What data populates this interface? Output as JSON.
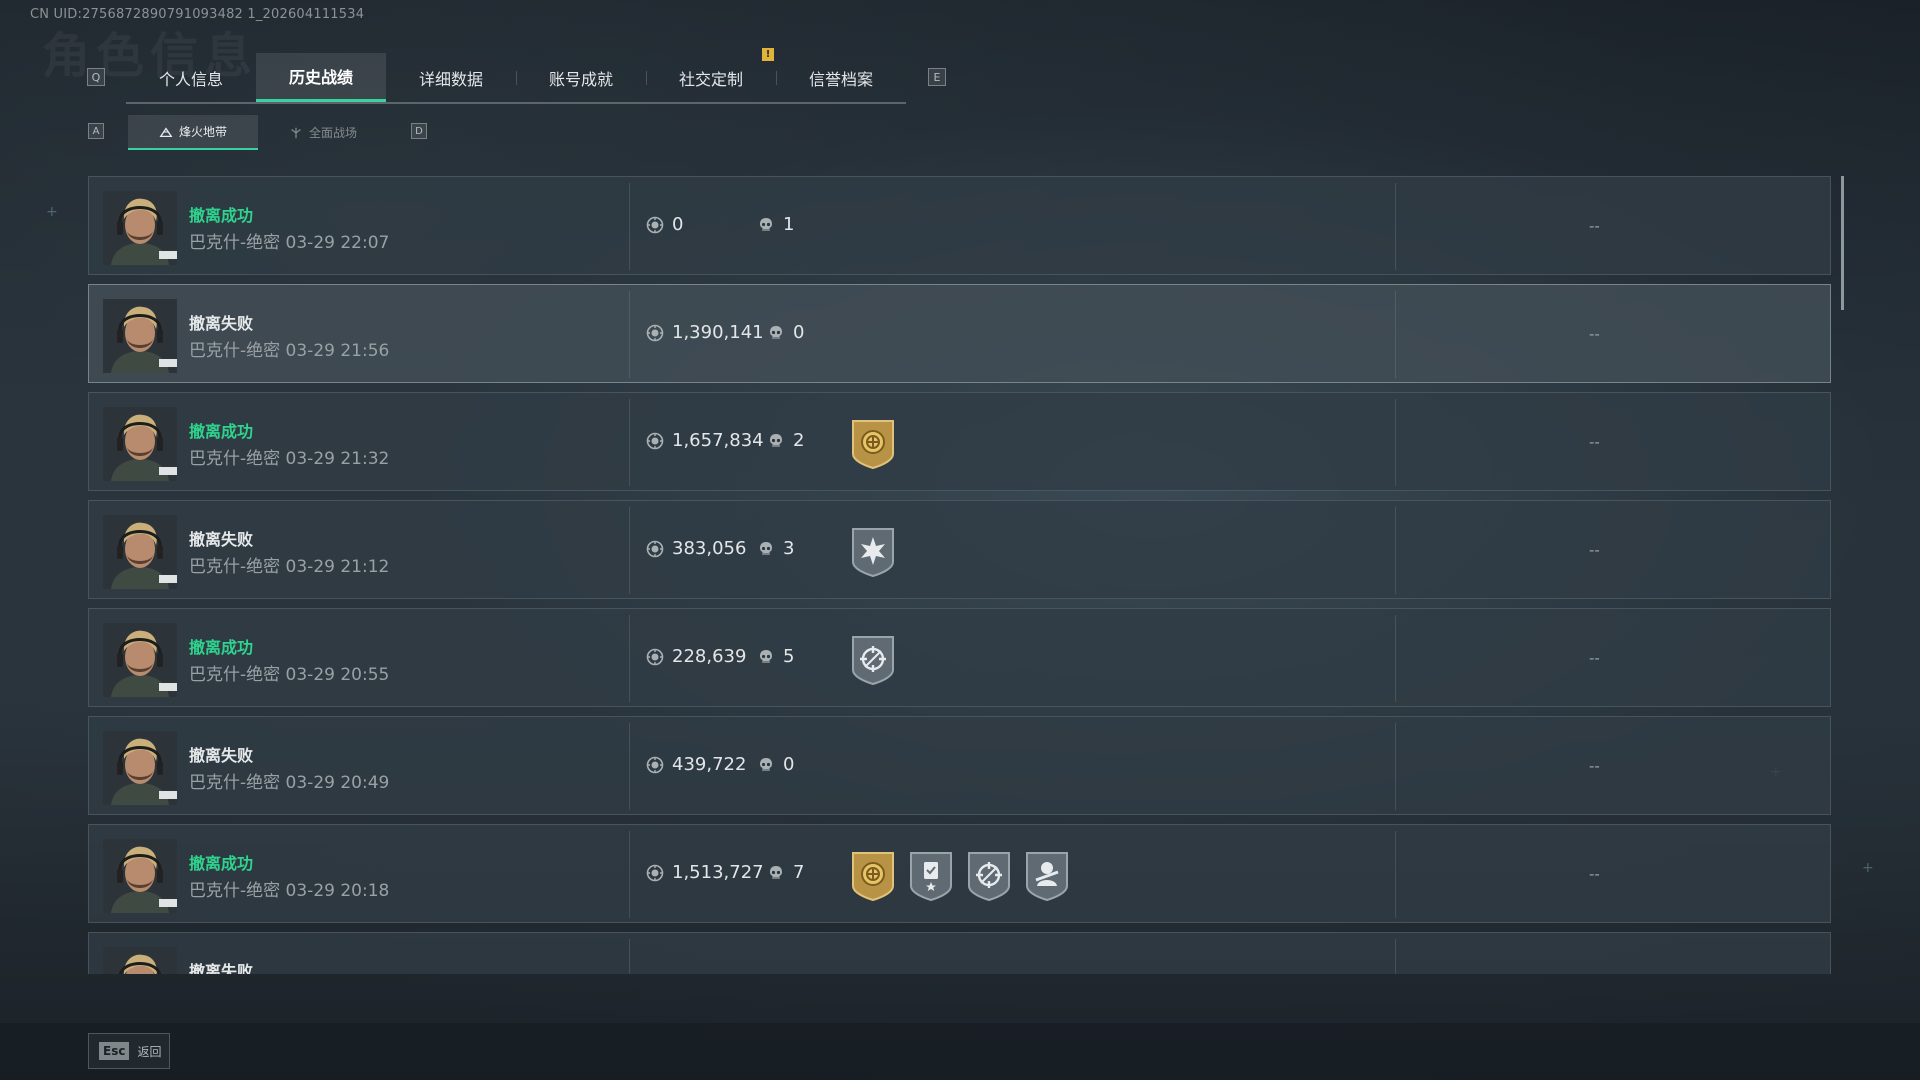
{
  "uid_label": "CN UID:2756872890791093482 1_202604111534",
  "background_title": "角色信息",
  "tab_key_left": "Q",
  "tab_key_right": "E",
  "tabs": [
    {
      "label": "个人信息",
      "active": false
    },
    {
      "label": "历史战绩",
      "active": true
    },
    {
      "label": "详细数据",
      "active": false
    },
    {
      "label": "账号成就",
      "active": false
    },
    {
      "label": "社交定制",
      "active": false
    },
    {
      "label": "信誉档案",
      "active": false
    }
  ],
  "notice_badge": "!",
  "subtab_key_left": "A",
  "subtab_key_right": "D",
  "subtabs": [
    {
      "label": "烽火地带",
      "icon": "mountain-icon",
      "active": true
    },
    {
      "label": "全面战场",
      "icon": "battlefield-icon",
      "active": false
    }
  ],
  "matches": [
    {
      "status": "撤离成功",
      "success": true,
      "map": "巴克什-绝密",
      "time": "03-29 22:07",
      "value": "0",
      "kills": "1",
      "badges": [],
      "extra": "--"
    },
    {
      "status": "撤离失败",
      "success": false,
      "map": "巴克什-绝密",
      "time": "03-29 21:56",
      "value": "1,390,141",
      "kills": "0",
      "badges": [],
      "extra": "--"
    },
    {
      "status": "撤离成功",
      "success": true,
      "map": "巴克什-绝密",
      "time": "03-29 21:32",
      "value": "1,657,834",
      "kills": "2",
      "badges": [
        "gold-coin-badge-icon"
      ],
      "extra": "--"
    },
    {
      "status": "撤离失败",
      "success": false,
      "map": "巴克什-绝密",
      "time": "03-29 21:12",
      "value": "383,056",
      "kills": "3",
      "badges": [
        "burst-star-badge-icon"
      ],
      "extra": "--"
    },
    {
      "status": "撤离成功",
      "success": true,
      "map": "巴克什-绝密",
      "time": "03-29 20:55",
      "value": "228,639",
      "kills": "5",
      "badges": [
        "crosshair-badge-icon"
      ],
      "extra": "--"
    },
    {
      "status": "撤离失败",
      "success": false,
      "map": "巴克什-绝密",
      "time": "03-29 20:49",
      "value": "439,722",
      "kills": "0",
      "badges": [],
      "extra": "--"
    },
    {
      "status": "撤离成功",
      "success": true,
      "map": "巴克什-绝密",
      "time": "03-29 20:18",
      "value": "1,513,727",
      "kills": "7",
      "badges": [
        "gold-coin-badge-icon",
        "clipboard-star-badge-icon",
        "crosshair-badge-icon",
        "soldier-badge-icon"
      ],
      "extra": "--"
    },
    {
      "status": "撤离失败",
      "success": false,
      "map": "",
      "time": "",
      "value": "",
      "kills": "",
      "badges": [],
      "extra": ""
    }
  ],
  "footer": {
    "esc_key": "Esc",
    "back_label": "返回"
  },
  "colors": {
    "accent": "#36d2a0",
    "success": "#2fd38e",
    "badge_gold": "#c9a24a",
    "badge_silver": "#6f7a82"
  }
}
